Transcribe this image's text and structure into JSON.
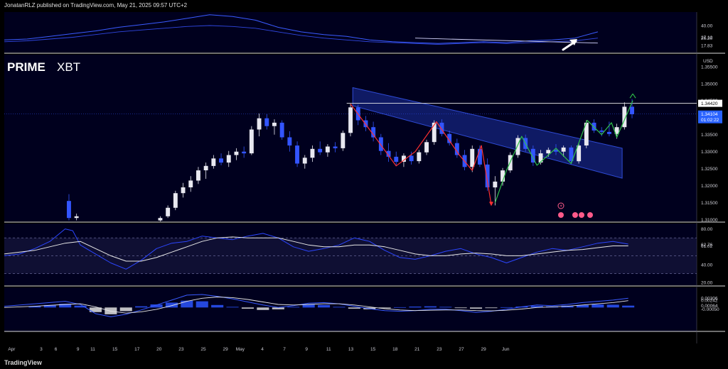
{
  "header": {
    "published": "JonatanRLZ published on TradingView.com, May 21, 2025 09:57 UTC+2"
  },
  "footer": {
    "logo_text": "TradingView"
  },
  "brand": {
    "bold": "PRIME",
    "light": "XBT"
  },
  "colors": {
    "background": "#000000",
    "panel": "#00001e",
    "bull_candle": "#e8e8f0",
    "bear_candle": "#3355ff",
    "channel": "#2f4bd6",
    "down_zigzag": "#ff3030",
    "up_zigzag": "#2fc24a",
    "rsi_line": "#2c46ff",
    "rsi_ma": "#e8e8e8",
    "macd_hist_pos": "#2c55ff",
    "macd_hist_neg": "#e0e0e0"
  },
  "icons": [
    "lightning-icon",
    "calendar-event-icon",
    "arrow-up-right-icon"
  ],
  "chart_data": [
    {
      "type": "line",
      "panel": "top-indicator",
      "y_ticks": [
        "40.00",
        "27.12",
        "26.20",
        "17.83"
      ],
      "y_range": [
        10,
        55
      ],
      "x_range": [
        0,
        91
      ],
      "series": [
        {
          "x": [
            0,
            3,
            6,
            9,
            12,
            15,
            18,
            21,
            24,
            27,
            30,
            33,
            36,
            39,
            42,
            45,
            48,
            51,
            54,
            57,
            60,
            63,
            66,
            69,
            72,
            75,
            78
          ],
          "values": [
            24,
            25,
            28,
            31,
            34,
            38,
            41,
            44,
            48,
            52,
            50,
            46,
            38,
            33,
            30,
            28,
            24,
            22,
            21,
            20,
            21,
            22,
            21,
            23,
            24,
            26,
            33
          ]
        },
        {
          "x": [
            0,
            3,
            6,
            9,
            12,
            15,
            18,
            21,
            24,
            27,
            30,
            33,
            36,
            39,
            42,
            45,
            48,
            51,
            54,
            57,
            60,
            63,
            66,
            69,
            72,
            75,
            78
          ],
          "values": [
            22,
            23,
            25,
            27,
            30,
            33,
            35,
            37,
            39,
            40,
            39,
            37,
            33,
            29,
            26,
            24,
            22,
            21,
            20,
            19,
            20,
            21,
            20,
            21,
            22,
            23,
            26
          ]
        }
      ],
      "annotations": [
        "trendline",
        "arrow-up-right"
      ]
    },
    {
      "type": "candlestick",
      "panel": "price",
      "currency": "USD",
      "y_ticks": [
        "1.35500",
        "1.35000",
        "1.34500",
        "1.33500",
        "1.33000",
        "1.32500",
        "1.32000",
        "1.31500",
        "1.31000"
      ],
      "y_range": [
        1.3095,
        1.3585
      ],
      "x_range": [
        0,
        91
      ],
      "price_tags": [
        {
          "price": 1.3442,
          "label": "1.34420"
        },
        {
          "price": 1.34104,
          "label": "1.34104",
          "countdown": "01:02:22"
        }
      ],
      "candles": [
        [
          8.5,
          1.3155,
          1.3175,
          1.3098,
          1.3105
        ],
        [
          9.5,
          1.3105,
          1.3118,
          1.3098,
          1.311
        ],
        [
          20.5,
          1.3098,
          1.311,
          1.3095,
          1.3105
        ],
        [
          21.5,
          1.311,
          1.3142,
          1.3105,
          1.3135
        ],
        [
          22.5,
          1.3135,
          1.3185,
          1.3128,
          1.3178
        ],
        [
          23.5,
          1.3178,
          1.3208,
          1.3165,
          1.3195
        ],
        [
          24.5,
          1.3195,
          1.3228,
          1.3182,
          1.3215
        ],
        [
          25.5,
          1.3215,
          1.3255,
          1.3205,
          1.3245
        ],
        [
          26.5,
          1.3245,
          1.3268,
          1.322,
          1.3258
        ],
        [
          27.5,
          1.3258,
          1.329,
          1.325,
          1.328
        ],
        [
          28.5,
          1.328,
          1.3295,
          1.326,
          1.3268
        ],
        [
          29.5,
          1.3268,
          1.3302,
          1.3255,
          1.329
        ],
        [
          30.5,
          1.329,
          1.331,
          1.3275,
          1.33
        ],
        [
          31.5,
          1.33,
          1.3315,
          1.3282,
          1.3295
        ],
        [
          32.5,
          1.3295,
          1.3375,
          1.329,
          1.3365
        ],
        [
          33.5,
          1.3365,
          1.3412,
          1.3345,
          1.3398
        ],
        [
          34.5,
          1.3398,
          1.341,
          1.3365,
          1.3375
        ],
        [
          35.5,
          1.3375,
          1.3395,
          1.335,
          1.3385
        ],
        [
          36.5,
          1.3385,
          1.3392,
          1.3335,
          1.3342
        ],
        [
          37.5,
          1.3342,
          1.336,
          1.33,
          1.3318
        ],
        [
          38.5,
          1.3318,
          1.333,
          1.3255,
          1.3265
        ],
        [
          39.5,
          1.3265,
          1.329,
          1.325,
          1.3282
        ],
        [
          40.5,
          1.3282,
          1.3318,
          1.327,
          1.3308
        ],
        [
          41.5,
          1.3308,
          1.333,
          1.329,
          1.3298
        ],
        [
          42.5,
          1.3298,
          1.3322,
          1.3285,
          1.3315
        ],
        [
          43.5,
          1.3315,
          1.3328,
          1.3298,
          1.331
        ],
        [
          44.5,
          1.331,
          1.3362,
          1.3302,
          1.3355
        ],
        [
          45.5,
          1.3355,
          1.344,
          1.3345,
          1.343
        ],
        [
          46.5,
          1.343,
          1.3438,
          1.3378,
          1.3392
        ],
        [
          47.5,
          1.3392,
          1.3405,
          1.336,
          1.3372
        ],
        [
          48.5,
          1.3372,
          1.3388,
          1.333,
          1.3342
        ],
        [
          49.5,
          1.3342,
          1.3352,
          1.329,
          1.3302
        ],
        [
          50.5,
          1.3302,
          1.3325,
          1.327,
          1.3285
        ],
        [
          51.5,
          1.3285,
          1.33,
          1.3258,
          1.327
        ],
        [
          52.5,
          1.327,
          1.3295,
          1.3255,
          1.3288
        ],
        [
          53.5,
          1.3288,
          1.33,
          1.3262,
          1.3272
        ],
        [
          54.5,
          1.3272,
          1.3305,
          1.3265,
          1.3298
        ],
        [
          55.5,
          1.3298,
          1.3335,
          1.329,
          1.3328
        ],
        [
          56.5,
          1.3328,
          1.3392,
          1.332,
          1.3385
        ],
        [
          57.5,
          1.3385,
          1.3395,
          1.3345,
          1.3352
        ],
        [
          58.5,
          1.3352,
          1.3362,
          1.3318,
          1.3325
        ],
        [
          59.5,
          1.3325,
          1.3338,
          1.3282,
          1.329
        ],
        [
          60.5,
          1.329,
          1.3305,
          1.3245,
          1.3255
        ],
        [
          61.5,
          1.3255,
          1.3318,
          1.324,
          1.3308
        ],
        [
          62.5,
          1.3308,
          1.3318,
          1.3255,
          1.3262
        ],
        [
          63.5,
          1.3262,
          1.328,
          1.3185,
          1.3195
        ],
        [
          64.5,
          1.3195,
          1.3228,
          1.3142,
          1.3212
        ],
        [
          65.5,
          1.3212,
          1.3252,
          1.32,
          1.3245
        ],
        [
          66.5,
          1.3245,
          1.3298,
          1.3238,
          1.329
        ],
        [
          67.5,
          1.329,
          1.3348,
          1.3282,
          1.334
        ],
        [
          68.5,
          1.334,
          1.335,
          1.33,
          1.3308
        ],
        [
          69.5,
          1.3308,
          1.3318,
          1.3258,
          1.3268
        ],
        [
          70.5,
          1.3268,
          1.3305,
          1.3262,
          1.3295
        ],
        [
          71.5,
          1.3295,
          1.3312,
          1.3285,
          1.3305
        ],
        [
          72.5,
          1.3305,
          1.3322,
          1.329,
          1.33
        ],
        [
          73.5,
          1.33,
          1.3318,
          1.3285,
          1.3312
        ],
        [
          74.5,
          1.3312,
          1.3318,
          1.3262,
          1.3272
        ],
        [
          75.5,
          1.3272,
          1.3325,
          1.3265,
          1.3318
        ],
        [
          76.5,
          1.3318,
          1.3392,
          1.331,
          1.3385
        ],
        [
          77.5,
          1.3385,
          1.3395,
          1.3355,
          1.3362
        ],
        [
          78.5,
          1.3362,
          1.3372,
          1.3345,
          1.3358
        ],
        [
          79.5,
          1.3358,
          1.3388,
          1.3345,
          1.3352
        ],
        [
          80.5,
          1.3352,
          1.3382,
          1.3338,
          1.3372
        ],
        [
          81.5,
          1.3372,
          1.3445,
          1.3365,
          1.3432
        ],
        [
          82.5,
          1.3432,
          1.3455,
          1.3398,
          1.341
        ]
      ],
      "annotations": [
        "descending-channel",
        "red-zigzag-wave",
        "green-zigzag-wave",
        "resistance-line-1.34420"
      ]
    },
    {
      "type": "line",
      "panel": "rsi",
      "y_ticks": [
        "80.00",
        "62.76",
        "61.02",
        "40.00",
        "20.00"
      ],
      "y_range": [
        17,
        86
      ],
      "x_range": [
        0,
        91
      ],
      "series": [
        {
          "x": [
            0,
            2,
            4,
            6,
            8,
            9,
            10,
            12,
            14,
            16,
            18,
            20,
            22,
            24,
            26,
            28,
            30,
            32,
            34,
            36,
            38,
            40,
            42,
            44,
            46,
            48,
            50,
            52,
            54,
            56,
            58,
            60,
            62,
            64,
            66,
            68,
            70,
            72,
            74,
            76,
            78,
            80,
            82
          ],
          "values": [
            50,
            52,
            58,
            66,
            80,
            78,
            62,
            52,
            42,
            35,
            45,
            58,
            64,
            66,
            72,
            70,
            68,
            72,
            75,
            70,
            60,
            55,
            58,
            62,
            70,
            66,
            56,
            48,
            46,
            50,
            55,
            58,
            52,
            48,
            42,
            48,
            54,
            58,
            56,
            60,
            64,
            66,
            63
          ]
        },
        {
          "x": [
            0,
            4,
            8,
            10,
            12,
            14,
            16,
            18,
            20,
            22,
            24,
            26,
            28,
            30,
            32,
            34,
            36,
            38,
            40,
            42,
            44,
            46,
            48,
            50,
            52,
            54,
            56,
            58,
            60,
            62,
            64,
            66,
            68,
            70,
            72,
            74,
            76,
            78,
            80,
            82
          ],
          "values": [
            52,
            56,
            64,
            66,
            58,
            50,
            44,
            44,
            48,
            54,
            60,
            66,
            70,
            71,
            70,
            70,
            70,
            66,
            62,
            60,
            60,
            62,
            62,
            60,
            56,
            52,
            50,
            50,
            52,
            53,
            52,
            50,
            50,
            52,
            54,
            56,
            57,
            59,
            61,
            61
          ]
        }
      ],
      "levels": [
        70,
        50,
        30
      ]
    },
    {
      "type": "bar",
      "panel": "macd",
      "y_ticks": [
        "0.00306",
        "0.00242",
        "0.00064",
        "-0.00050"
      ],
      "y_range": [
        -0.0075,
        0.0065
      ],
      "x_range": [
        0,
        91
      ],
      "histogram": {
        "x": [
          4,
          6,
          8,
          10,
          12,
          14,
          16,
          18,
          20,
          22,
          24,
          26,
          28,
          30,
          32,
          34,
          36,
          38,
          40,
          42,
          44,
          46,
          48,
          50,
          52,
          54,
          56,
          58,
          60,
          62,
          64,
          66,
          68,
          70,
          72,
          74,
          76,
          78,
          80,
          82
        ],
        "values": [
          0.0004,
          0.0008,
          0.0012,
          0.0006,
          -0.0015,
          -0.0022,
          -0.0012,
          0.0004,
          0.001,
          0.0016,
          0.0022,
          0.002,
          0.0008,
          0.0002,
          -0.0004,
          -0.0008,
          -0.0006,
          0.0002,
          0.001,
          0.0008,
          0.0002,
          -0.0004,
          -0.0006,
          -0.0003,
          0.0001,
          0.0003,
          0.0004,
          0.0002,
          -0.0002,
          -0.0004,
          -0.0002,
          0.0001,
          0.0003,
          0.0005,
          0.0004,
          0.0006,
          0.0008,
          0.001,
          0.0009,
          0.0006
        ]
      },
      "series": [
        {
          "x": [
            0,
            4,
            8,
            10,
            12,
            14,
            16,
            18,
            20,
            22,
            24,
            26,
            28,
            30,
            32,
            34,
            36,
            38,
            40,
            42,
            44,
            46,
            48,
            50,
            52,
            54,
            56,
            58,
            60,
            62,
            64,
            66,
            68,
            70,
            72,
            74,
            76,
            78,
            80,
            82
          ],
          "values": [
            0.0004,
            0.0012,
            0.002,
            0.001,
            -0.002,
            -0.003,
            -0.0022,
            -0.0008,
            0.0008,
            0.0024,
            0.004,
            0.0042,
            0.0036,
            0.0028,
            0.0018,
            0.0008,
            0.0,
            0.0006,
            0.0014,
            0.0016,
            0.0012,
            0.0004,
            -0.0004,
            -0.001,
            -0.0012,
            -0.001,
            -0.0006,
            -0.0006,
            -0.001,
            -0.0016,
            -0.0012,
            -0.0006,
            0.0002,
            0.0008,
            0.0006,
            0.001,
            0.0016,
            0.002,
            0.0024,
            0.003
          ]
        },
        {
          "x": [
            0,
            4,
            8,
            10,
            12,
            14,
            16,
            18,
            20,
            22,
            24,
            26,
            28,
            30,
            32,
            34,
            36,
            38,
            40,
            42,
            44,
            46,
            48,
            50,
            52,
            54,
            56,
            58,
            60,
            62,
            64,
            66,
            68,
            70,
            72,
            74,
            76,
            78,
            80,
            82
          ],
          "values": [
            0.0,
            0.0004,
            0.001,
            0.0012,
            0.0002,
            -0.0012,
            -0.0018,
            -0.0014,
            -0.0006,
            0.0006,
            0.002,
            0.003,
            0.0034,
            0.0032,
            0.0026,
            0.0018,
            0.001,
            0.0008,
            0.001,
            0.0012,
            0.0012,
            0.0008,
            0.0002,
            -0.0004,
            -0.0008,
            -0.001,
            -0.0009,
            -0.0008,
            -0.0008,
            -0.001,
            -0.0011,
            -0.0009,
            -0.0005,
            0.0,
            0.0002,
            0.0004,
            0.0008,
            0.0012,
            0.0016,
            0.0022
          ]
        }
      ]
    }
  ],
  "x_axis": {
    "labels": [
      {
        "x": 1,
        "label": "Apr"
      },
      {
        "x": 5,
        "label": "3"
      },
      {
        "x": 7,
        "label": "6"
      },
      {
        "x": 10,
        "label": "9"
      },
      {
        "x": 12,
        "label": "11"
      },
      {
        "x": 15,
        "label": "15"
      },
      {
        "x": 18,
        "label": "17"
      },
      {
        "x": 21,
        "label": "20"
      },
      {
        "x": 24,
        "label": "23"
      },
      {
        "x": 27,
        "label": "25"
      },
      {
        "x": 30,
        "label": "29"
      },
      {
        "x": 32,
        "label": "May"
      },
      {
        "x": 35,
        "label": "4"
      },
      {
        "x": 38,
        "label": "7"
      },
      {
        "x": 41,
        "label": "9"
      },
      {
        "x": 44,
        "label": "11"
      },
      {
        "x": 47,
        "label": "13"
      },
      {
        "x": 50,
        "label": "15"
      },
      {
        "x": 53,
        "label": "18"
      },
      {
        "x": 56,
        "label": "21"
      },
      {
        "x": 59,
        "label": "23"
      },
      {
        "x": 62,
        "label": "27"
      },
      {
        "x": 65,
        "label": "29"
      },
      {
        "x": 68,
        "label": "Jun"
      }
    ]
  }
}
